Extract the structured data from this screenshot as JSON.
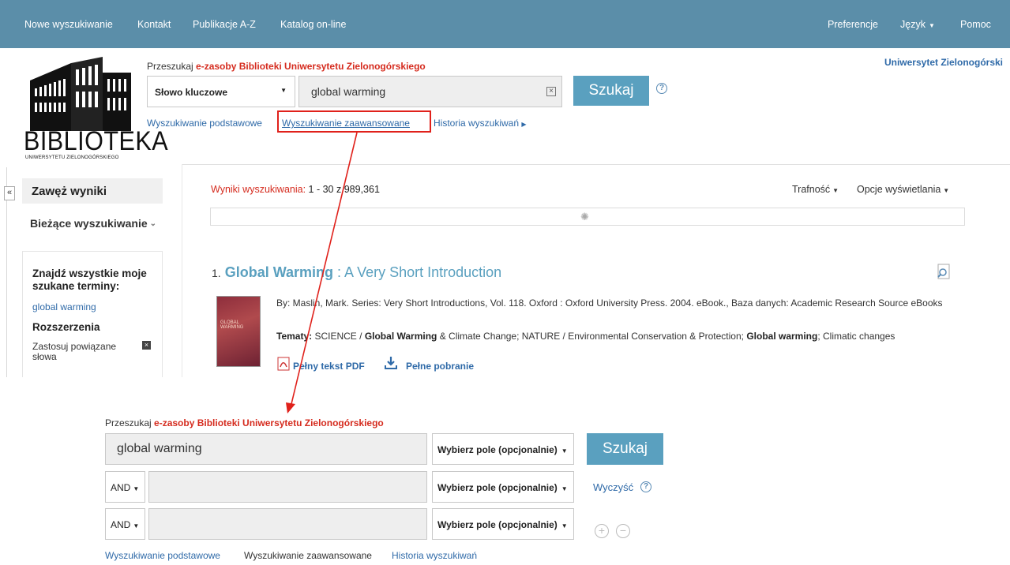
{
  "topnav": {
    "new_search": "Nowe wyszukiwanie",
    "contact": "Kontakt",
    "publications": "Publikacje A-Z",
    "catalog": "Katalog on-line",
    "preferences": "Preferencje",
    "language": "Język",
    "help": "Pomoc"
  },
  "logo": {
    "name": "BIBLIOTEKA",
    "subtitle": "UNIWERSYTETU ZIELONOGÓRSKIEGO"
  },
  "institution": "Uniwersytet Zielonogórski",
  "search": {
    "prompt_prefix": "Przeszukaj",
    "prompt_library": "e-zasoby Biblioteki Uniwersytetu Zielonogórskiego",
    "field": "Słowo kluczowe",
    "query": "global warming",
    "button": "Szukaj",
    "help": "?",
    "links": {
      "basic": "Wyszukiwanie podstawowe",
      "advanced": "Wyszukiwanie zaawansowane",
      "history": "Historia wyszukiwań"
    }
  },
  "sidebar": {
    "collapse": "«",
    "title": "Zawęż wyniki",
    "current_search": "Bieżące wyszukiwanie",
    "find_all_terms": "Znajdź wszystkie moje szukane terminy:",
    "term": "global warming",
    "expanders": "Rozszerzenia",
    "apply_related": "Zastosuj powiązane słowa",
    "remove": "×"
  },
  "results": {
    "summary_label": "Wyniki wyszukiwania:",
    "summary_range": "1 - 30 z 989,361",
    "sort": "Trafność",
    "display_options": "Opcje wyświetlania",
    "items": [
      {
        "number": "1.",
        "title_highlight": "Global Warming",
        "title_rest": " : A Very Short Introduction",
        "cover_text": "GLOBAL WARMING",
        "meta": "By: Maslin, Mark. Series: Very Short Introductions, Vol. 118. Oxford : Oxford University Press. 2004. eBook., Baza danych: Academic Research Source eBooks",
        "subjects_label": "Tematy:",
        "subjects_1": " SCIENCE / ",
        "subjects_hl1": "Global Warming",
        "subjects_2": " & Climate Change; NATURE / Environmental Conservation & Protection; ",
        "subjects_hl2": "Global warming",
        "subjects_3": "; Climatic changes",
        "pdf": "Pełny tekst PDF",
        "download": "Pełne pobranie"
      }
    ]
  },
  "advanced": {
    "prompt_prefix": "Przeszukaj",
    "prompt_library": "e-zasoby Biblioteki Uniwersytetu Zielonogórskiego",
    "rows": [
      {
        "operator": "",
        "value": "global warming",
        "field": "Wybierz pole (opcjonalnie)"
      },
      {
        "operator": "AND",
        "value": "",
        "field": "Wybierz pole (opcjonalnie)"
      },
      {
        "operator": "AND",
        "value": "",
        "field": "Wybierz pole (opcjonalnie)"
      }
    ],
    "search_button": "Szukaj",
    "clear": "Wyczyść",
    "help": "?",
    "add": "+",
    "remove": "−",
    "links": {
      "basic": "Wyszukiwanie podstawowe",
      "advanced": "Wyszukiwanie zaawansowane",
      "history": "Historia wyszukiwań"
    }
  },
  "colors": {
    "nav_bg": "#5b8ea9",
    "accent": "#5aa0bf",
    "highlight": "#e0211b",
    "link": "#2f6aa8"
  }
}
